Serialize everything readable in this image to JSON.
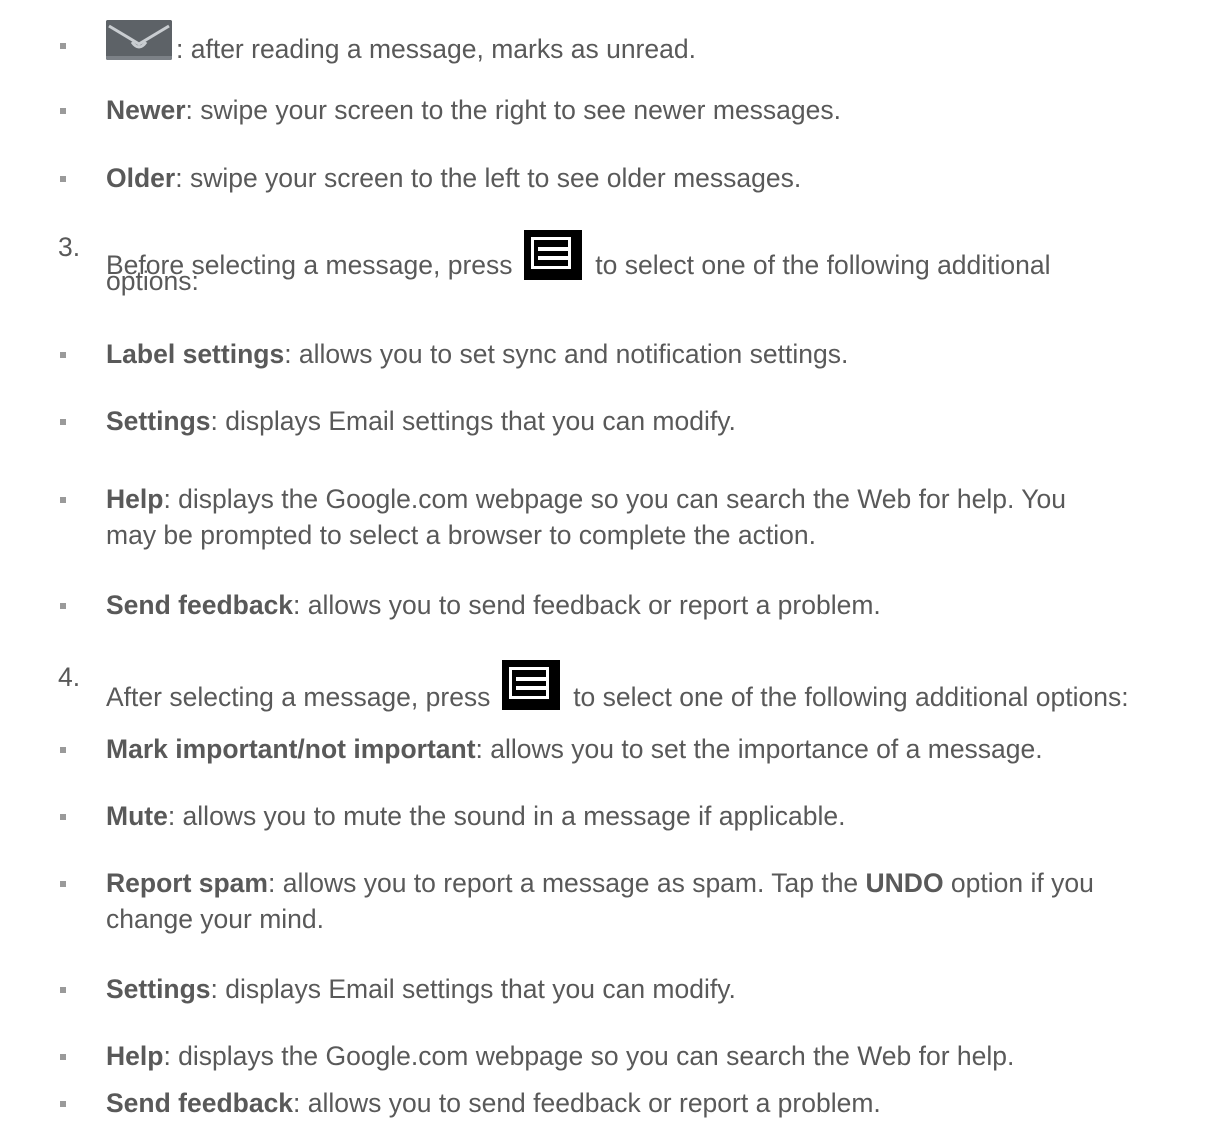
{
  "list_a": {
    "items": [
      {
        "label": "",
        "text": ": after reading a message, marks as unread.",
        "icon": "mark-unread-envelope-icon"
      },
      {
        "label": "Newer",
        "text": ": swipe your screen to the right to see newer messages."
      },
      {
        "label": "Older",
        "text": ": swipe your screen to the left to see older messages."
      }
    ]
  },
  "step3": {
    "number": "3.",
    "text_before": "Before selecting a message, press",
    "text_after": "to select one of the following additional",
    "text_line2": "options:",
    "icon": "menu-key-icon",
    "items": [
      {
        "label": "Label settings",
        "text": ": allows you to set sync and notification settings."
      },
      {
        "label": "Settings",
        "text": ": displays Email settings that you can modify."
      },
      {
        "label": "Help",
        "text": ": displays the Google.com webpage so you can search the Web for help. You",
        "line2": "may be prompted to select a browser to complete the action."
      },
      {
        "label": "Send feedback",
        "text": ": allows you to send feedback or report a problem."
      }
    ]
  },
  "step4": {
    "number": "4.",
    "text_before": "After selecting a message, press",
    "text_after": "to select one of the following additional options:",
    "icon": "menu-key-icon",
    "items": [
      {
        "label": "Mark important/not important",
        "text": ": allows you to set the importance of a message."
      },
      {
        "label": "Mute",
        "text": ": allows you to mute the sound in a message if applicable."
      },
      {
        "label": "Report spam",
        "text": ": allows you to report a message as spam. Tap the ",
        "bold2": "UNDO",
        "text2": " option if you",
        "line2": "change your mind."
      },
      {
        "label": "Settings",
        "text": ": displays Email settings that you can modify."
      },
      {
        "label": "Help",
        "text": ": displays the Google.com webpage so you can search the Web for help."
      },
      {
        "label": "Send feedback",
        "text": ": allows you to send feedback or report a problem."
      }
    ]
  }
}
